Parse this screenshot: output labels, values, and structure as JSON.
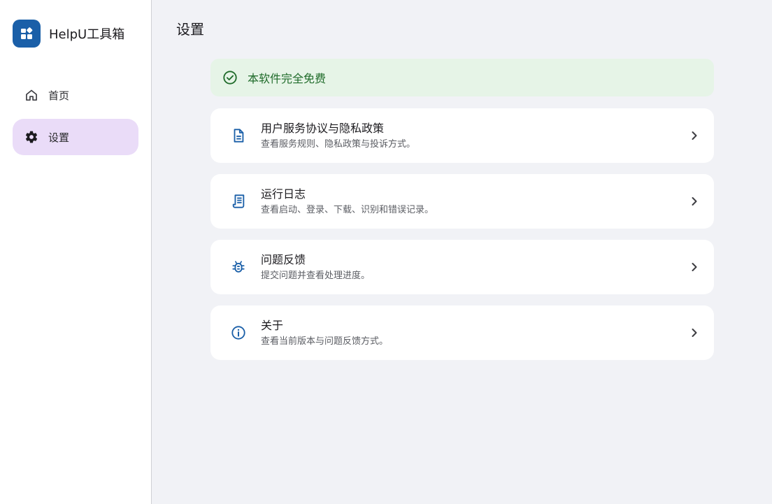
{
  "brand": {
    "name": "HelpU工具箱",
    "logo_icon": "widgets-icon",
    "logo_color": "#1a5fa8"
  },
  "sidebar": {
    "items": [
      {
        "label": "首页",
        "icon": "home-icon",
        "active": false
      },
      {
        "label": "设置",
        "icon": "gear-icon",
        "active": true
      }
    ],
    "active_color": "#eadcf8"
  },
  "main": {
    "title": "设置",
    "banner": {
      "text": "本软件完全免费",
      "icon": "check-circle-icon",
      "color": "#1f6b2a",
      "background": "#e6f4e7"
    },
    "cards": [
      {
        "title": "用户服务协议与隐私政策",
        "desc": "查看服务规则、隐私政策与投诉方式。",
        "icon": "document-icon"
      },
      {
        "title": "运行日志",
        "desc": "查看启动、登录、下载、识别和错误记录。",
        "icon": "receipt-log-icon"
      },
      {
        "title": "问题反馈",
        "desc": "提交问题并查看处理进度。",
        "icon": "bug-icon"
      },
      {
        "title": "关于",
        "desc": "查看当前版本与问题反馈方式。",
        "icon": "info-icon"
      }
    ],
    "accent_color": "#1a5fa8"
  }
}
